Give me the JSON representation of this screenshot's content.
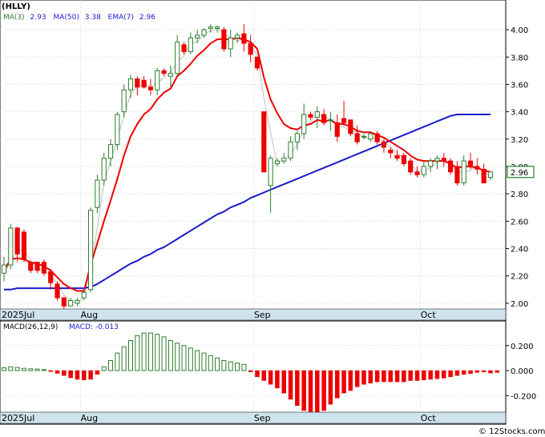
{
  "chart_data": [
    {
      "type": "candlestick",
      "ticker_label": "(HLLY)",
      "legend": {
        "ma3": "MA(3)",
        "ma3_value": "2.93",
        "ma50": "MA(50)",
        "ma50_value": "3.38",
        "ema7": "EMA(7)",
        "ema7_value": "2.96"
      },
      "last_price_label": "2.96",
      "y_ticks": [
        "4.00",
        "3.80",
        "3.60",
        "3.40",
        "3.20",
        "3.00",
        "2.80",
        "2.60",
        "2.40",
        "2.20",
        "2.00"
      ],
      "x_labels": [
        "2025Jul",
        "Aug",
        "Sep",
        "Oct"
      ],
      "candles": [
        [
          2.22,
          2.34,
          2.16,
          2.28
        ],
        [
          2.28,
          2.58,
          2.25,
          2.55
        ],
        [
          2.55,
          2.56,
          2.3,
          2.36
        ],
        [
          2.52,
          2.54,
          2.3,
          2.32
        ],
        [
          2.3,
          2.3,
          2.22,
          2.24
        ],
        [
          2.3,
          2.3,
          2.22,
          2.24
        ],
        [
          2.3,
          2.32,
          2.2,
          2.22
        ],
        [
          2.23,
          2.25,
          2.1,
          2.15
        ],
        [
          2.14,
          2.16,
          2.02,
          2.04
        ],
        [
          2.04,
          2.04,
          1.96,
          1.98
        ],
        [
          1.98,
          2.04,
          1.98,
          2.02
        ],
        [
          2.0,
          2.04,
          1.98,
          2.02
        ],
        [
          2.04,
          2.1,
          2.02,
          2.08
        ],
        [
          2.1,
          2.7,
          2.08,
          2.68
        ],
        [
          2.7,
          2.94,
          2.66,
          2.9
        ],
        [
          2.9,
          3.1,
          2.86,
          3.06
        ],
        [
          3.06,
          3.2,
          3.0,
          3.16
        ],
        [
          3.16,
          3.4,
          3.12,
          3.38
        ],
        [
          3.4,
          3.6,
          3.36,
          3.56
        ],
        [
          3.56,
          3.67,
          3.5,
          3.64
        ],
        [
          3.64,
          3.66,
          3.52,
          3.58
        ],
        [
          3.63,
          3.66,
          3.57,
          3.58
        ],
        [
          3.58,
          3.64,
          3.52,
          3.56
        ],
        [
          3.56,
          3.72,
          3.52,
          3.7
        ],
        [
          3.7,
          3.72,
          3.66,
          3.68
        ],
        [
          3.66,
          3.74,
          3.58,
          3.68
        ],
        [
          3.68,
          3.96,
          3.66,
          3.91
        ],
        [
          3.89,
          3.91,
          3.82,
          3.84
        ],
        [
          3.84,
          3.98,
          3.82,
          3.94
        ],
        [
          3.94,
          4.0,
          3.9,
          3.96
        ],
        [
          3.96,
          4.01,
          3.94,
          4.0
        ],
        [
          4.01,
          4.04,
          3.98,
          4.02
        ],
        [
          4.01,
          4.03,
          3.98,
          4.02
        ],
        [
          4.0,
          4.02,
          3.84,
          3.86
        ],
        [
          3.86,
          4.0,
          3.8,
          3.94
        ],
        [
          3.94,
          3.98,
          3.9,
          3.96
        ],
        [
          3.97,
          4.04,
          3.84,
          3.9
        ],
        [
          3.9,
          3.96,
          3.76,
          3.82
        ],
        [
          3.8,
          3.8,
          3.7,
          3.72
        ],
        [
          3.4,
          3.4,
          2.96,
          2.96
        ],
        [
          2.86,
          3.08,
          2.66,
          3.06
        ],
        [
          3.02,
          3.06,
          3.0,
          3.04
        ],
        [
          3.04,
          3.1,
          3.02,
          3.06
        ],
        [
          3.06,
          3.22,
          3.04,
          3.18
        ],
        [
          3.18,
          3.26,
          3.12,
          3.24
        ],
        [
          3.24,
          3.46,
          3.2,
          3.38
        ],
        [
          3.38,
          3.4,
          3.34,
          3.36
        ],
        [
          3.36,
          3.44,
          3.28,
          3.4
        ],
        [
          3.38,
          3.42,
          3.3,
          3.32
        ],
        [
          3.34,
          3.4,
          3.26,
          3.34
        ],
        [
          3.32,
          3.38,
          3.18,
          3.22
        ],
        [
          3.35,
          3.48,
          3.3,
          3.32
        ],
        [
          3.34,
          3.34,
          3.22,
          3.24
        ],
        [
          3.24,
          3.3,
          3.16,
          3.18
        ],
        [
          3.22,
          3.24,
          3.2,
          3.22
        ],
        [
          3.2,
          3.24,
          3.18,
          3.24
        ],
        [
          3.24,
          3.26,
          3.16,
          3.18
        ],
        [
          3.18,
          3.2,
          3.1,
          3.14
        ],
        [
          3.12,
          3.14,
          3.06,
          3.1
        ],
        [
          3.08,
          3.12,
          3.04,
          3.06
        ],
        [
          3.08,
          3.1,
          3.0,
          3.02
        ],
        [
          3.04,
          3.06,
          2.94,
          2.96
        ],
        [
          2.96,
          3.0,
          2.92,
          2.94
        ],
        [
          2.94,
          3.04,
          2.92,
          3.0
        ],
        [
          3.0,
          3.06,
          2.96,
          3.04
        ],
        [
          3.04,
          3.08,
          2.98,
          3.06
        ],
        [
          3.06,
          3.1,
          3.0,
          3.04
        ],
        [
          3.04,
          3.06,
          2.94,
          2.96
        ],
        [
          3.0,
          3.04,
          2.86,
          2.88
        ],
        [
          2.88,
          3.08,
          2.86,
          3.04
        ],
        [
          3.04,
          3.1,
          2.98,
          3.0
        ],
        [
          3.0,
          3.06,
          2.94,
          2.98
        ],
        [
          2.98,
          3.02,
          2.88,
          2.88
        ],
        [
          2.92,
          2.96,
          2.9,
          2.96
        ]
      ],
      "ma50": [
        2.1,
        2.1,
        2.11,
        2.11,
        2.11,
        2.11,
        2.11,
        2.11,
        2.11,
        2.11,
        2.11,
        2.11,
        2.11,
        2.12,
        2.14,
        2.17,
        2.2,
        2.23,
        2.26,
        2.29,
        2.31,
        2.34,
        2.36,
        2.39,
        2.41,
        2.44,
        2.47,
        2.5,
        2.53,
        2.56,
        2.59,
        2.62,
        2.65,
        2.67,
        2.7,
        2.72,
        2.74,
        2.77,
        2.79,
        2.81,
        2.83,
        2.85,
        2.87,
        2.89,
        2.91,
        2.93,
        2.95,
        2.97,
        2.99,
        3.01,
        3.03,
        3.05,
        3.07,
        3.09,
        3.11,
        3.13,
        3.15,
        3.17,
        3.19,
        3.21,
        3.23,
        3.25,
        3.27,
        3.29,
        3.31,
        3.33,
        3.35,
        3.37,
        3.38,
        3.38,
        3.38,
        3.38,
        3.38,
        3.38
      ],
      "ema7": [
        2.24,
        2.32,
        2.33,
        2.32,
        2.3,
        2.29,
        2.27,
        2.24,
        2.19,
        2.14,
        2.11,
        2.09,
        2.09,
        2.28,
        2.44,
        2.6,
        2.75,
        2.91,
        3.08,
        3.22,
        3.31,
        3.38,
        3.42,
        3.49,
        3.54,
        3.57,
        3.66,
        3.7,
        3.75,
        3.81,
        3.85,
        3.9,
        3.93,
        3.93,
        3.93,
        3.94,
        3.93,
        3.91,
        3.86,
        3.65,
        3.49,
        3.39,
        3.31,
        3.28,
        3.27,
        3.3,
        3.31,
        3.34,
        3.33,
        3.34,
        3.31,
        3.31,
        3.29,
        3.26,
        3.25,
        3.25,
        3.23,
        3.21,
        3.18,
        3.15,
        3.12,
        3.08,
        3.05,
        3.04,
        3.04,
        3.04,
        3.04,
        3.02,
        2.99,
        3.0,
        3.0,
        2.99,
        2.97,
        2.96
      ],
      "ma3": [
        2.22,
        2.3,
        2.37,
        2.4,
        2.31,
        2.26,
        2.23,
        2.2,
        2.14,
        2.06,
        2.01,
        2.01,
        2.04,
        2.26,
        2.55,
        2.88,
        3.04,
        3.2,
        3.37,
        3.53,
        3.59,
        3.6,
        3.58,
        3.61,
        3.65,
        3.69,
        3.76,
        3.81,
        3.9,
        3.91,
        3.97,
        3.99,
        4.01,
        3.97,
        3.94,
        3.92,
        3.93,
        3.89,
        3.81,
        3.5,
        3.25,
        3.02,
        3.05,
        3.09,
        3.16,
        3.27,
        3.33,
        3.38,
        3.36,
        3.35,
        3.29,
        3.29,
        3.26,
        3.25,
        3.21,
        3.21,
        3.21,
        3.18,
        3.14,
        3.1,
        3.06,
        3.01,
        2.97,
        2.97,
        2.99,
        3.03,
        3.05,
        3.02,
        2.96,
        2.96,
        2.97,
        3.01,
        2.95,
        2.94
      ],
      "y_range": [
        1.97,
        4.1
      ]
    },
    {
      "type": "bar",
      "title": "MACD(26,12,9)",
      "macd_label": "MACD:",
      "macd_value": "-0.013",
      "y_ticks": [
        "0.200",
        "0.000",
        "-0.200"
      ],
      "x_labels": [
        "2025Jul",
        "Aug",
        "Sep",
        "Oct"
      ],
      "values": [
        0.022,
        0.03,
        0.025,
        0.018,
        0.014,
        0.012,
        0.008,
        -0.008,
        -0.022,
        -0.04,
        -0.058,
        -0.07,
        -0.075,
        -0.07,
        -0.03,
        0.03,
        0.08,
        0.14,
        0.19,
        0.24,
        0.28,
        0.3,
        0.3,
        0.29,
        0.27,
        0.24,
        0.22,
        0.2,
        0.18,
        0.16,
        0.14,
        0.12,
        0.1,
        0.08,
        0.07,
        0.06,
        0.05,
        -0.01,
        -0.05,
        -0.08,
        -0.11,
        -0.14,
        -0.18,
        -0.23,
        -0.28,
        -0.32,
        -0.34,
        -0.34,
        -0.32,
        -0.27,
        -0.22,
        -0.18,
        -0.16,
        -0.13,
        -0.11,
        -0.1,
        -0.09,
        -0.09,
        -0.09,
        -0.09,
        -0.09,
        -0.08,
        -0.08,
        -0.075,
        -0.07,
        -0.065,
        -0.06,
        -0.05,
        -0.04,
        -0.03,
        -0.025,
        -0.015,
        -0.01,
        -0.02,
        -0.015
      ],
      "y_range": [
        -0.32,
        0.32
      ]
    }
  ],
  "colors": {
    "up": "#2e7d2e",
    "down": "#ee0000",
    "ma3": "#c0c0c0",
    "ma50": "#1a1acd",
    "ema7": "#ee0000",
    "axis_band": "#cfe3ee",
    "price_box": "#006600"
  },
  "watermark": "© 12Stocks.com"
}
